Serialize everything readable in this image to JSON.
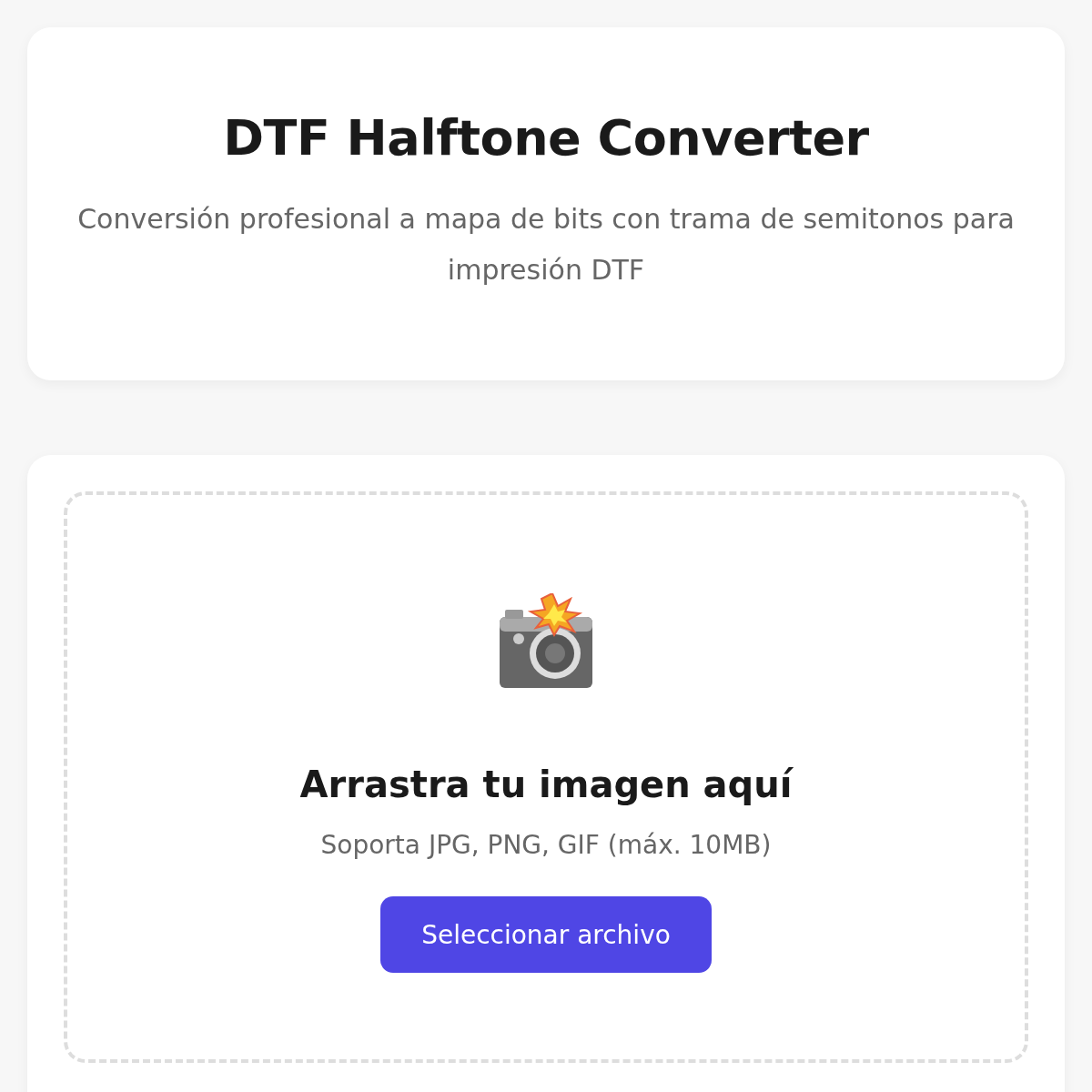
{
  "header": {
    "title": "DTF Halftone Converter",
    "subtitle": "Conversión profesional a mapa de bits con trama de semitonos para impresión DTF"
  },
  "upload": {
    "heading": "Arrastra tu imagen aquí",
    "hint": "Soporta JPG, PNG, GIF (máx. 10MB)",
    "button": "Seleccionar archivo"
  }
}
